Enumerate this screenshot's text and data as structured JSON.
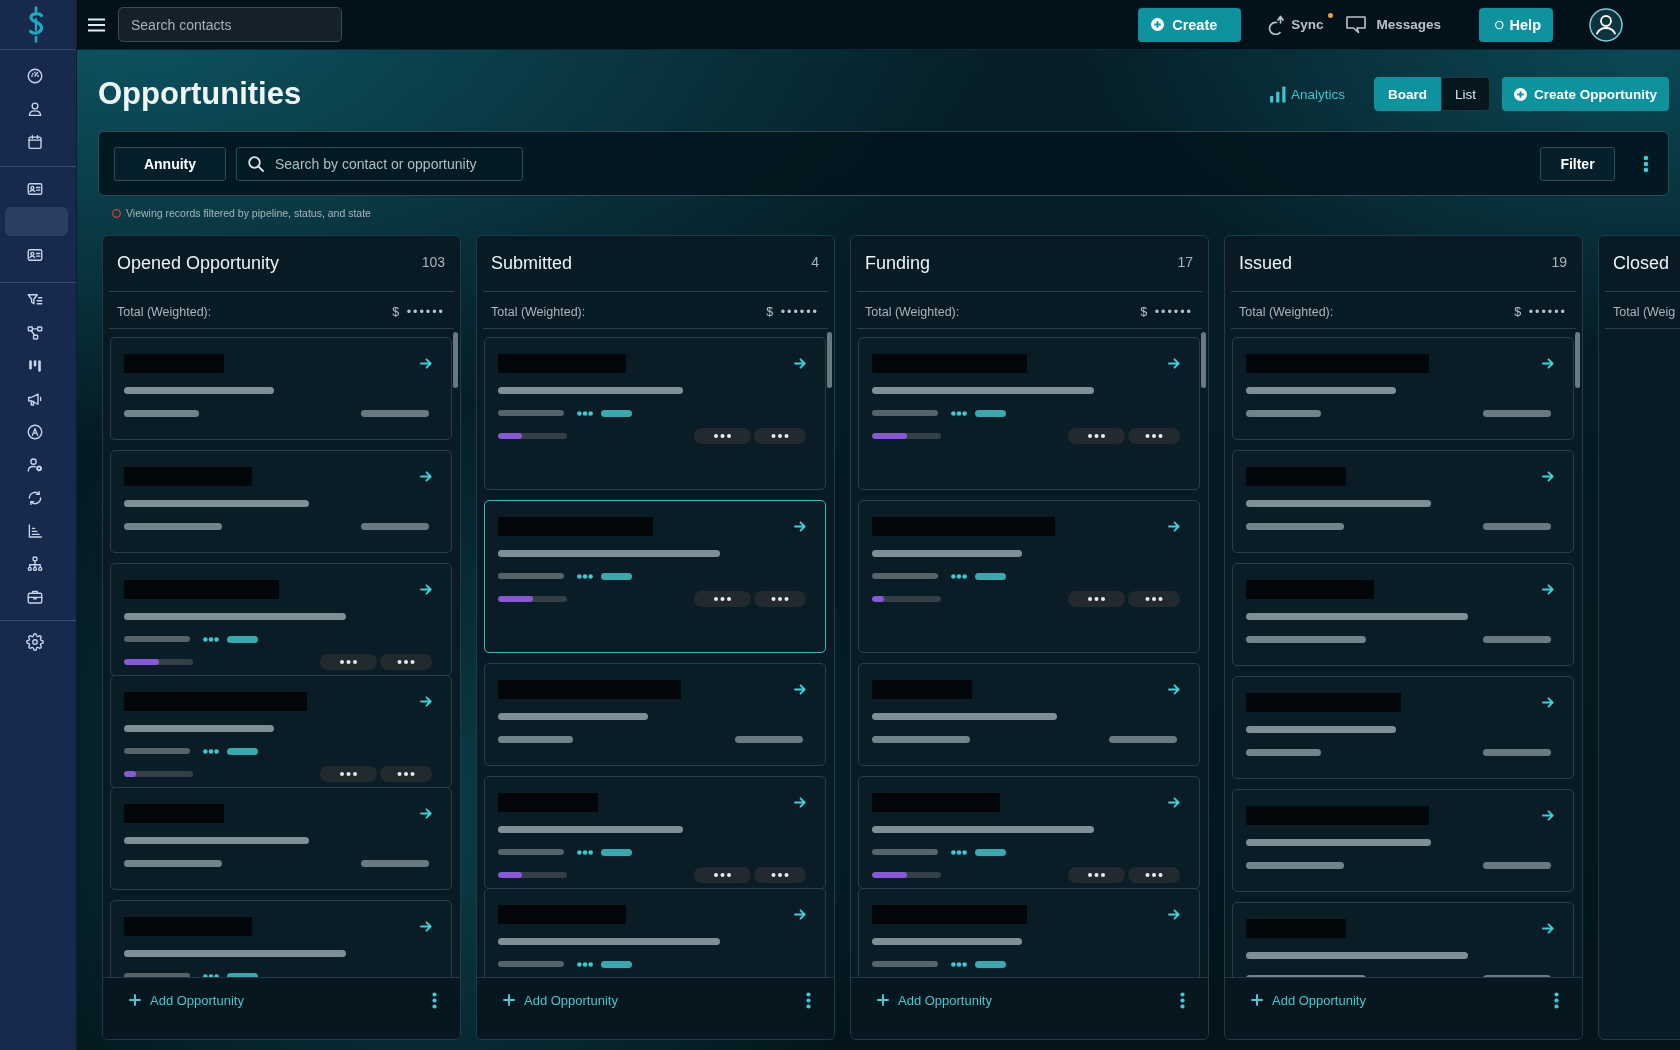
{
  "sidebar": {
    "groups": [
      {
        "items": [
          {
            "selected": false
          },
          {
            "selected": false
          },
          {
            "selected": false
          }
        ]
      },
      {
        "items": [
          {
            "selected": false
          },
          {
            "selected": true
          },
          {
            "selected": false
          }
        ]
      },
      {
        "items": [
          {
            "selected": false
          },
          {
            "selected": false
          },
          {
            "selected": false
          },
          {
            "selected": false
          },
          {
            "selected": false
          },
          {
            "selected": false
          },
          {
            "selected": false
          },
          {
            "selected": false
          },
          {
            "selected": false
          },
          {
            "selected": false
          }
        ]
      },
      {
        "items": [
          {
            "selected": false
          }
        ]
      }
    ]
  },
  "top_bar": {
    "search": {
      "placeholder": "Search contacts"
    },
    "create_button": "Create",
    "sync": {
      "label": "Sync",
      "notification": true
    },
    "messages": "Messages",
    "help_button": "Help"
  },
  "header": {
    "title": "Opportunities",
    "analytics_link": "Analytics",
    "views": [
      {
        "label": "Board",
        "selected": true
      },
      {
        "label": "List",
        "selected": false
      }
    ],
    "create_button": "Create Opportunity"
  },
  "filter_bar": {
    "pipeline_button": "Annuity",
    "search": {
      "placeholder": "Search by contact or opportunity"
    },
    "filter_button": "Filter",
    "note": "Viewing records filtered by pipeline, status, and state"
  },
  "columns": [
    {
      "title": "Opened Opportunity",
      "count": "103",
      "total_label": "Total (Weighted):",
      "total_value": "$ ••••••",
      "add_label": "Add Opportunity",
      "cards": [
        {
          "kind": "summary",
          "selected": false
        },
        {
          "kind": "summary",
          "selected": false
        },
        {
          "kind": "detail",
          "selected": false,
          "level": 0.5
        },
        {
          "kind": "detail",
          "selected": false,
          "level": 0.17
        },
        {
          "kind": "summary",
          "selected": false
        },
        {
          "kind": "detail",
          "selected": false
        }
      ]
    },
    {
      "title": "Submitted",
      "count": "4",
      "total_label": "Total (Weighted):",
      "total_value": "$ ••••••",
      "add_label": "Add Opportunity",
      "cards": [
        {
          "kind": "expanded",
          "selected": false,
          "level": 0.35
        },
        {
          "kind": "expanded",
          "selected": true,
          "level": 0.5
        },
        {
          "kind": "summary",
          "selected": false
        },
        {
          "kind": "detail",
          "selected": false,
          "level": 0.35
        },
        {
          "kind": "detail",
          "selected": false
        }
      ]
    },
    {
      "title": "Funding",
      "count": "17",
      "total_label": "Total (Weighted):",
      "total_value": "$ ••••••",
      "add_label": "Add Opportunity",
      "cards": [
        {
          "kind": "expanded",
          "selected": false,
          "level": 0.5
        },
        {
          "kind": "expanded",
          "selected": false,
          "level": 0.17
        },
        {
          "kind": "summary",
          "selected": false
        },
        {
          "kind": "detail",
          "selected": false,
          "level": 0.5
        },
        {
          "kind": "detail",
          "selected": false
        }
      ]
    },
    {
      "title": "Issued",
      "count": "19",
      "total_label": "Total (Weighted):",
      "total_value": "$ ••••••",
      "add_label": "Add Opportunity",
      "cards": [
        {
          "kind": "summary",
          "selected": false
        },
        {
          "kind": "summary",
          "selected": false
        },
        {
          "kind": "summary",
          "selected": false
        },
        {
          "kind": "summary",
          "selected": false
        },
        {
          "kind": "summary",
          "selected": false
        },
        {
          "kind": "summary",
          "selected": false
        }
      ]
    },
    {
      "title": "Closed",
      "total_label": "Total (Weig"
    }
  ]
}
